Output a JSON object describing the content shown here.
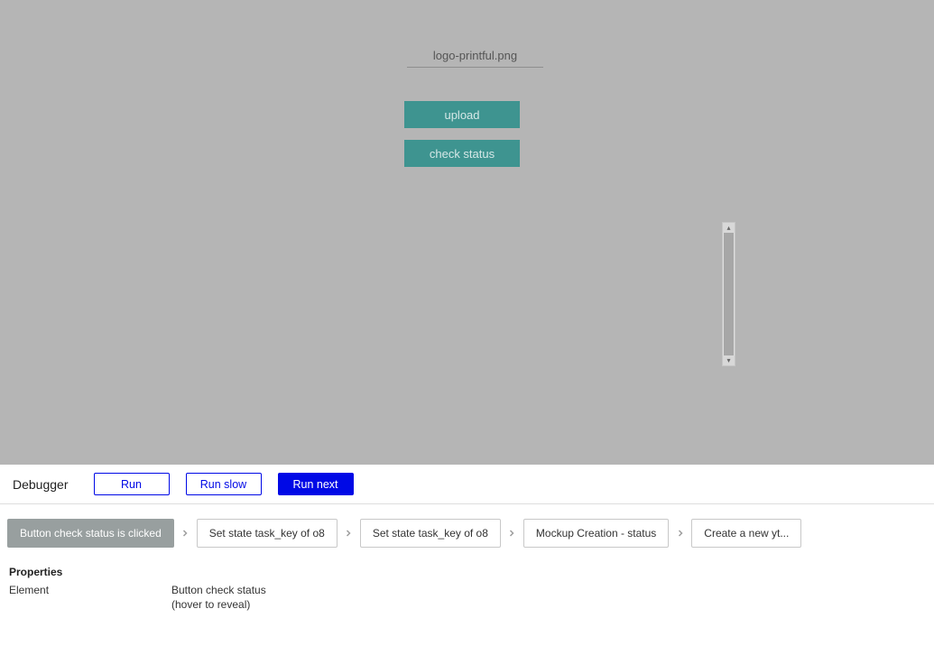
{
  "preview": {
    "filename": "logo-printful.png",
    "upload_label": "upload",
    "check_status_label": "check status"
  },
  "debugger": {
    "title": "Debugger",
    "buttons": {
      "run": "Run",
      "run_slow": "Run slow",
      "run_next": "Run next"
    },
    "flow": [
      {
        "label": "Button check status is clicked",
        "active": true
      },
      {
        "label": "Set state task_key of o8",
        "active": false
      },
      {
        "label": "Set state task_key of o8",
        "active": false
      },
      {
        "label": "Mockup Creation - status",
        "active": false
      },
      {
        "label": "Create a new yt...",
        "active": false
      }
    ],
    "properties": {
      "title": "Properties",
      "element_label": "Element",
      "element_value": "Button check status (hover to reveal)"
    }
  }
}
